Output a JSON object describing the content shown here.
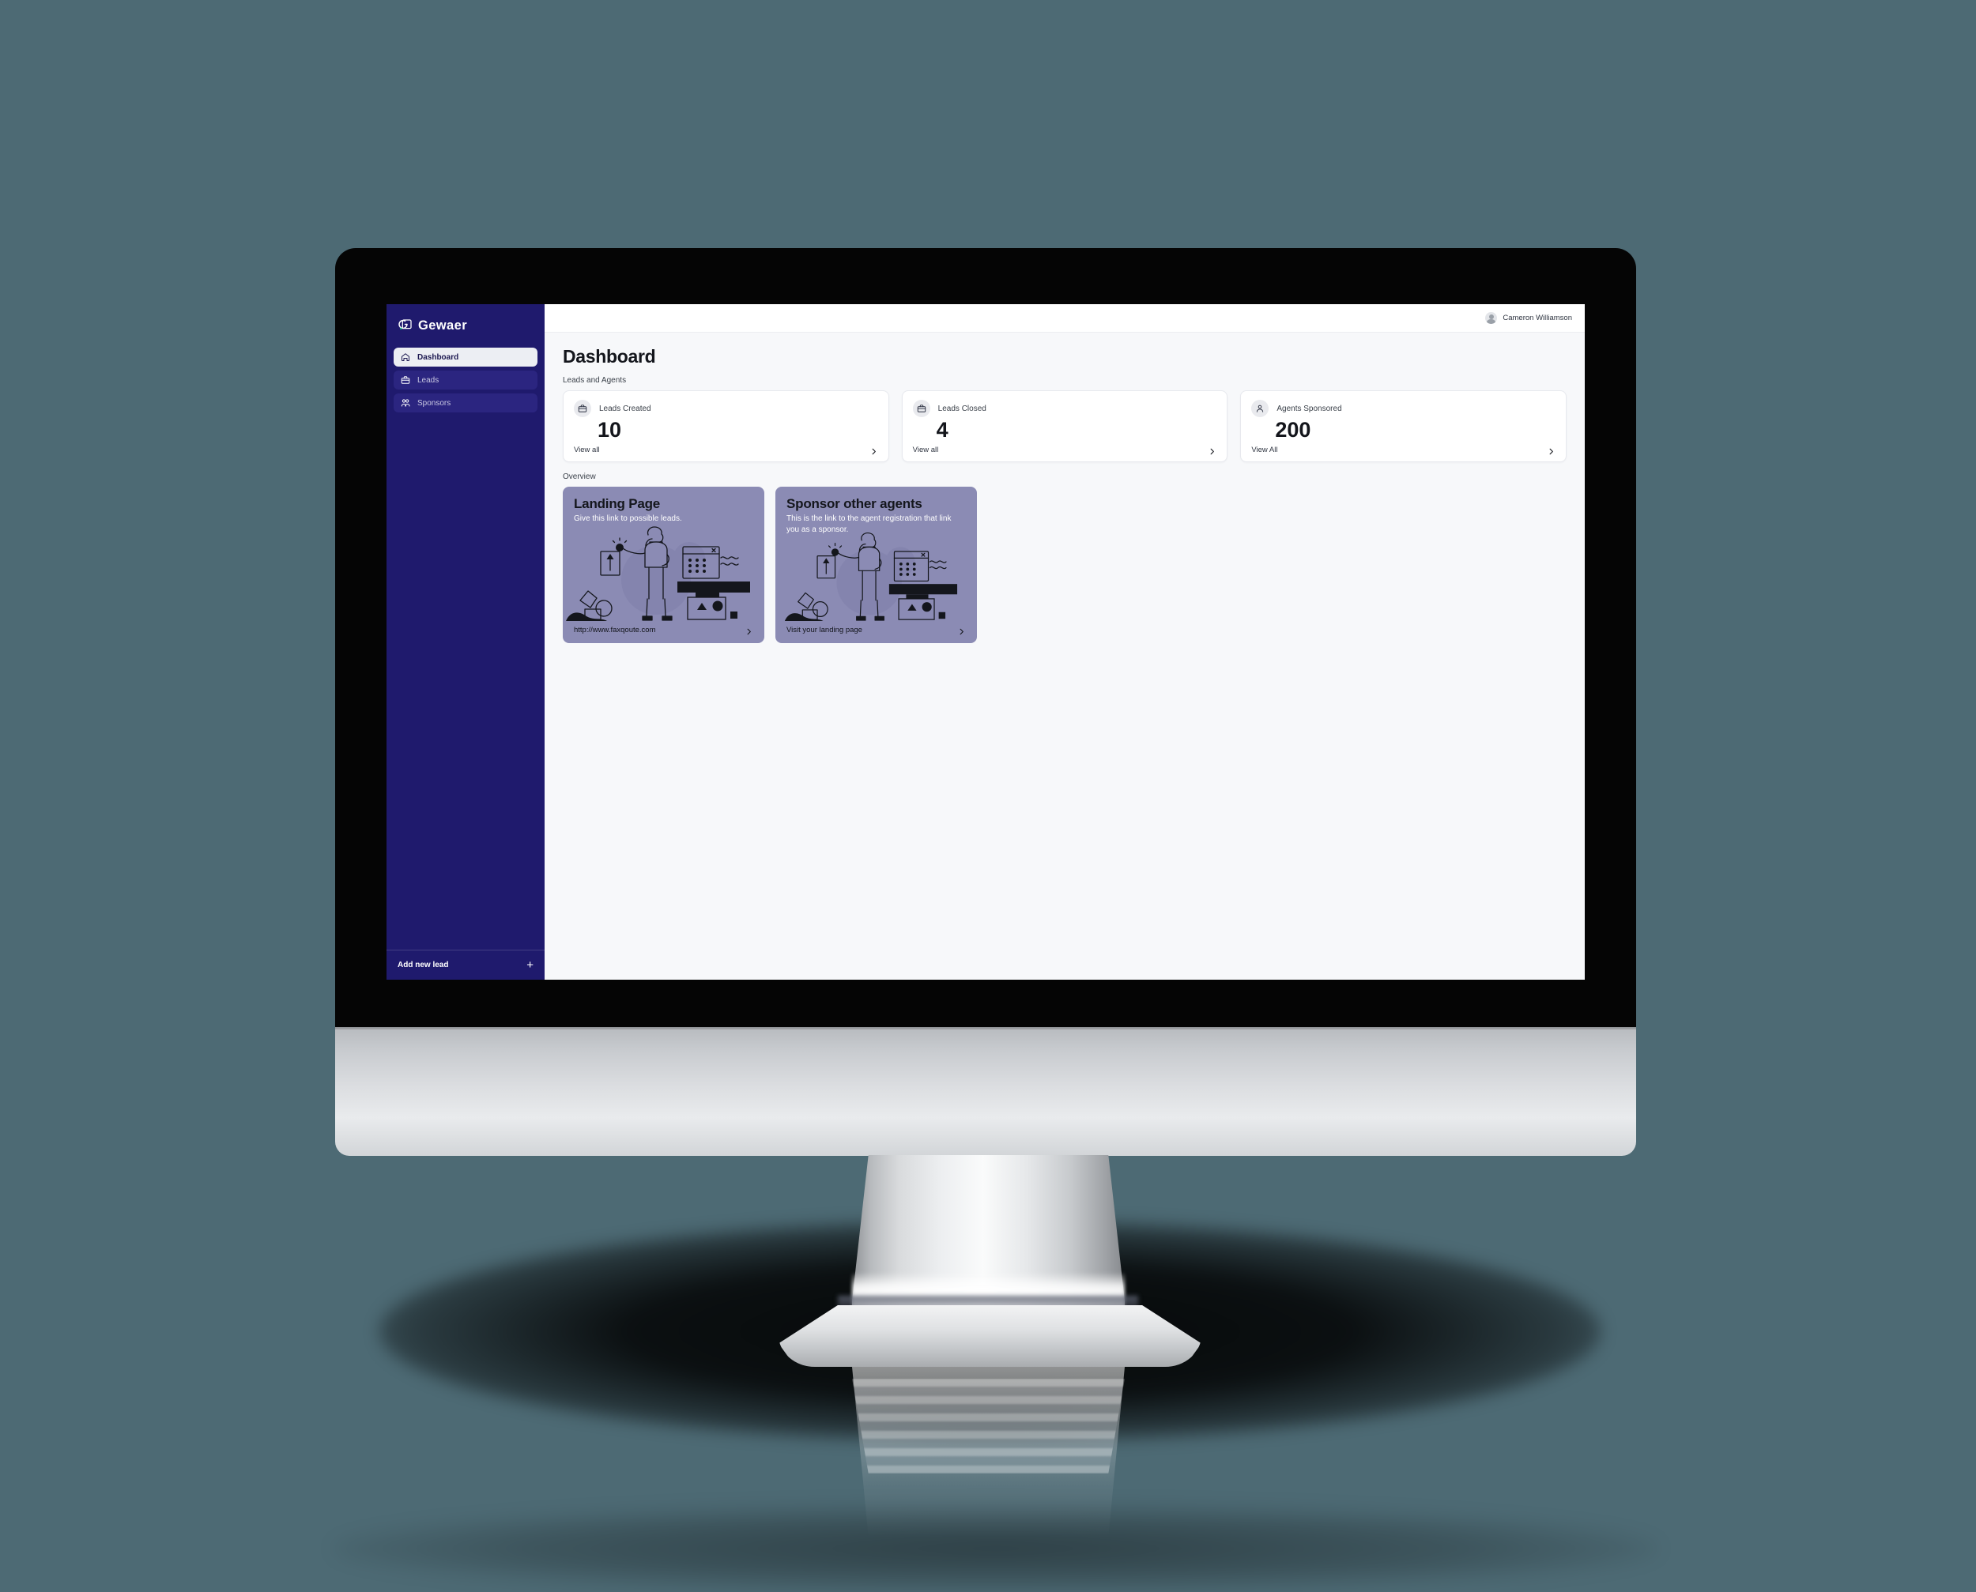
{
  "background": {
    "color": "#4d6a74"
  },
  "device": {
    "type": "desktop-monitor",
    "bezel_color": "#050505",
    "stand_color": "#d8dadc"
  },
  "app": {
    "sidebar": {
      "brand": {
        "name": "Gewaer",
        "logo_icon": "g-logo-icon"
      },
      "items": [
        {
          "label": "Dashboard",
          "icon": "home-icon",
          "active": true
        },
        {
          "label": "Leads",
          "icon": "briefcase-icon",
          "active": false
        },
        {
          "label": "Sponsors",
          "icon": "users-icon",
          "active": false
        }
      ],
      "footer": {
        "label": "Add new lead",
        "icon": "plus-icon"
      },
      "colors": {
        "background": "#1f1a6d",
        "item_background": "#2b2580",
        "active_background": "#eceef3"
      }
    },
    "topbar": {
      "user": {
        "name": "Cameron Williamson",
        "avatar_icon": "user-avatar-icon"
      }
    },
    "main": {
      "page_title": "Dashboard",
      "sections": [
        {
          "label": "Leads and Agents"
        },
        {
          "label": "Overview"
        }
      ],
      "stats": [
        {
          "label": "Leads Created",
          "value": "10",
          "link": "View all",
          "icon": "briefcase-icon",
          "chevron": "chevron-right-icon"
        },
        {
          "label": "Leads Closed",
          "value": "4",
          "link": "View all",
          "icon": "briefcase-icon",
          "chevron": "chevron-right-icon"
        },
        {
          "label": "Agents Sponsored",
          "value": "200",
          "link": "View All",
          "icon": "user-icon",
          "chevron": "chevron-right-icon"
        }
      ],
      "promos": [
        {
          "title": "Landing Page",
          "subtitle": "Give this link to possible leads.",
          "link": "http://www.faxqoute.com",
          "chevron": "chevron-right-icon",
          "illustration": "person-with-dashboard-illustration",
          "color": "#8b8bb4"
        },
        {
          "title": "Sponsor other agents",
          "subtitle": "This is the link to the agent registration that link you as a sponsor.",
          "link": "Visit your landing page",
          "chevron": "chevron-right-icon",
          "illustration": "person-with-dashboard-illustration",
          "color": "#8b8bb4"
        }
      ]
    }
  }
}
